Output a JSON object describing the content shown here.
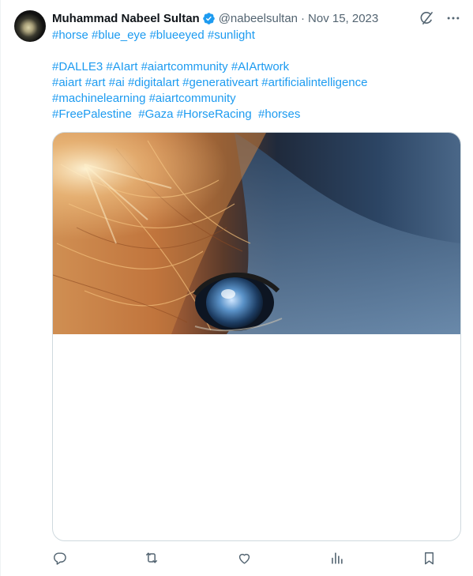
{
  "tweet": {
    "author_name": "Muhammad Nabeel Sultan",
    "handle": "@nabeelsultan",
    "separator": "·",
    "date": "Nov 15, 2023",
    "text_lines": [
      [
        "#horse",
        "#blue_eye",
        "#blueeyed",
        "#sunlight"
      ],
      [],
      [
        "#DALLE3",
        "#AIart",
        "#aiartcommunity",
        "#AIArtwork"
      ],
      [
        "#aiart",
        "#art",
        "#ai",
        "#digitalart",
        "#generativeart",
        "#artificialintelligence"
      ],
      [
        "#machinelearning",
        "#aiartcommunity"
      ],
      [
        "#FreePalestine",
        "#Gaza",
        "#HorseRacing",
        "#horses"
      ]
    ]
  },
  "icons": {
    "verified": "verified-badge-icon",
    "grok": "grok-icon",
    "more": "more-icon",
    "reply": "reply-icon",
    "retweet": "retweet-icon",
    "like": "like-icon",
    "views": "views-icon",
    "bookmark": "bookmark-icon"
  },
  "colors": {
    "link": "#1d9bf0",
    "text": "#0f1419",
    "secondary": "#536471",
    "border": "#cfd9de"
  }
}
